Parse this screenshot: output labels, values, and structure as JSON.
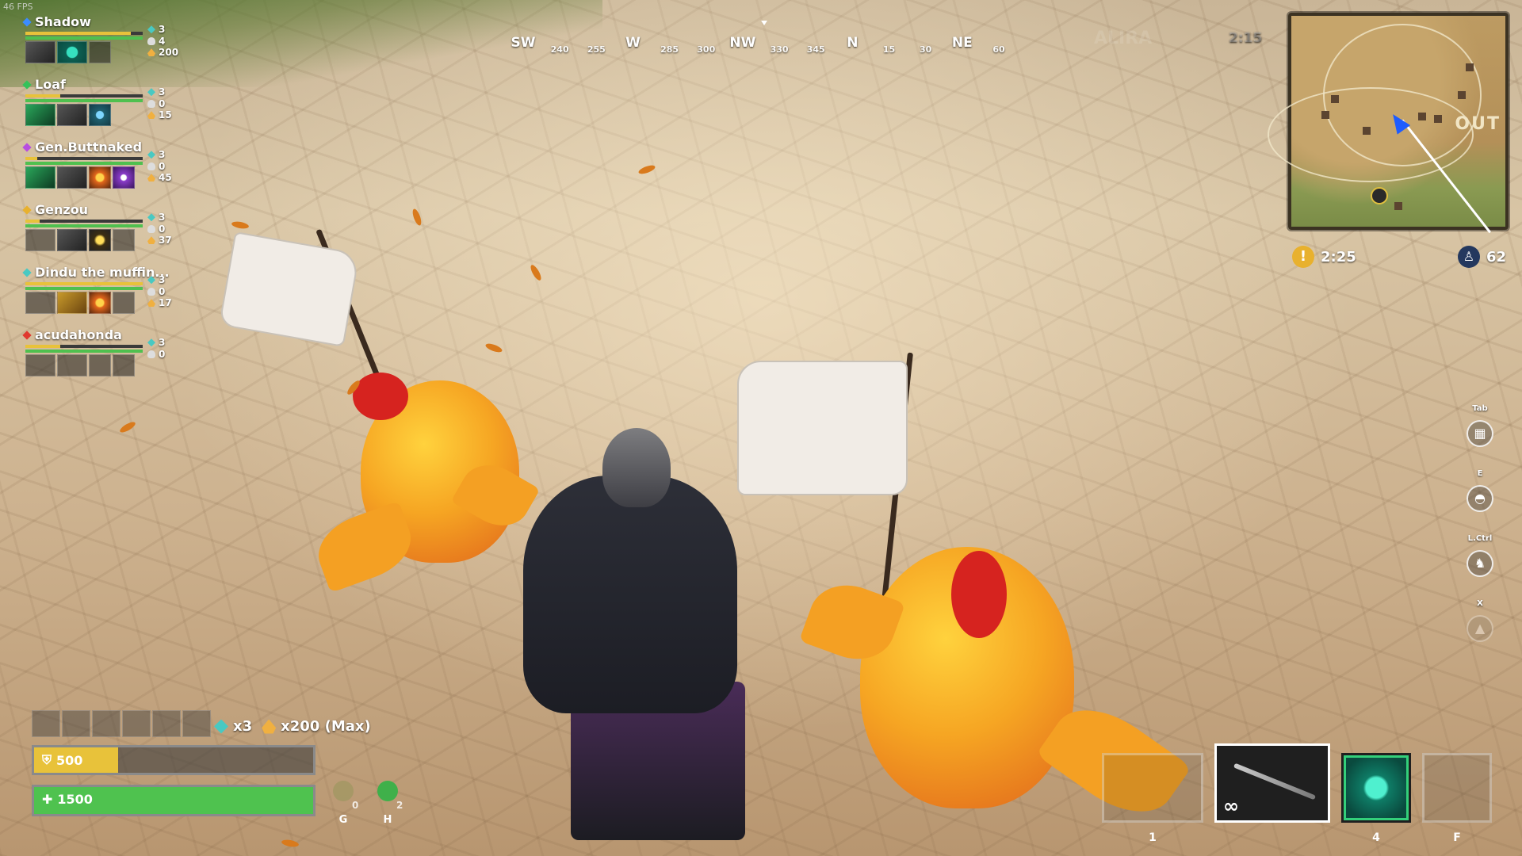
{
  "hud": {
    "fps": "46 FPS",
    "match_timer": "2:15",
    "ghost_label": "ALIRA"
  },
  "party": [
    {
      "name": "Shadow",
      "color": "#3b8cff",
      "armor": 0.9,
      "health": 1.0,
      "slots": [
        "weapon",
        "teal-eye",
        ""
      ],
      "shards": "3",
      "kills": "4",
      "amber": "200"
    },
    {
      "name": "Loaf",
      "color": "#34c25a",
      "armor": 0.3,
      "health": 1.0,
      "slots": [
        "green-weapon",
        "weapon",
        "blue-ability"
      ],
      "shards": "3",
      "kills": "0",
      "amber": "15"
    },
    {
      "name": "Gen.Buttnaked",
      "color": "#b74de0",
      "armor": 0.1,
      "health": 1.0,
      "slots": [
        "green-weapon",
        "weapon",
        "fire-ability",
        "purple-ability"
      ],
      "shards": "3",
      "kills": "0",
      "amber": "45"
    },
    {
      "name": "Genzou",
      "color": "#e8b12e",
      "armor": 0.12,
      "health": 1.0,
      "slots": [
        "",
        "weapon",
        "yellow-ability",
        ""
      ],
      "shards": "3",
      "kills": "0",
      "amber": "37"
    },
    {
      "name": "Dindu the muffin...",
      "color": "#49c9c2",
      "armor": 1.0,
      "health": 1.0,
      "slots": [
        "",
        "gold-weapon",
        "fire-ability",
        ""
      ],
      "shards": "3",
      "kills": "0",
      "amber": "17"
    },
    {
      "name": "acudahonda",
      "color": "#e0392f",
      "armor": 0.3,
      "health": 1.0,
      "slots": [
        "",
        "",
        "",
        ""
      ],
      "shards": "3",
      "kills": "0",
      "amber": ""
    }
  ],
  "compass": {
    "marks": [
      {
        "label": "SW",
        "major": true
      },
      {
        "label": "240",
        "major": false
      },
      {
        "label": "255",
        "major": false
      },
      {
        "label": "W",
        "major": true
      },
      {
        "label": "285",
        "major": false
      },
      {
        "label": "300",
        "major": false
      },
      {
        "label": "NW",
        "major": true
      },
      {
        "label": "330",
        "major": false
      },
      {
        "label": "345",
        "major": false
      },
      {
        "label": "N",
        "major": true
      },
      {
        "label": "15",
        "major": false
      },
      {
        "label": "30",
        "major": false
      },
      {
        "label": "NE",
        "major": true
      },
      {
        "label": "60",
        "major": false
      }
    ]
  },
  "minimap": {
    "zone_label": "OUT",
    "zone_timer": "2:25",
    "zone_icon": "!",
    "players_alive": "62",
    "alive_icon": "person-icon"
  },
  "abilities": [
    {
      "key": "Tab",
      "icon": "grid-icon",
      "glyph": "▦",
      "enabled": true
    },
    {
      "key": "E",
      "icon": "helmet-icon",
      "glyph": "◓",
      "enabled": true
    },
    {
      "key": "L.Ctrl",
      "icon": "mount-icon",
      "glyph": "♞",
      "enabled": true
    },
    {
      "key": "X",
      "icon": "ultimate-icon",
      "glyph": "▲",
      "enabled": false
    }
  ],
  "inventory": {
    "cells": 6,
    "shard_count": "x3",
    "amber_count": "x200 (Max)"
  },
  "vitals": {
    "armor_value": "500",
    "armor_fraction": 0.3,
    "health_value": "1500",
    "health_fraction": 1.0,
    "armor_color": "#e8c23a",
    "health_color": "#4fc24f"
  },
  "potions": [
    {
      "key": "G",
      "count": "0",
      "type": "shield-potion"
    },
    {
      "key": "H",
      "count": "2",
      "type": "health-potion"
    }
  ],
  "weapon_slots": [
    {
      "key": "1",
      "type": "empty-weapon"
    },
    {
      "key": "",
      "type": "sword",
      "ammo": "∞"
    },
    {
      "key": "4",
      "type": "eye-ability"
    },
    {
      "key": "F",
      "type": "empty"
    }
  ]
}
